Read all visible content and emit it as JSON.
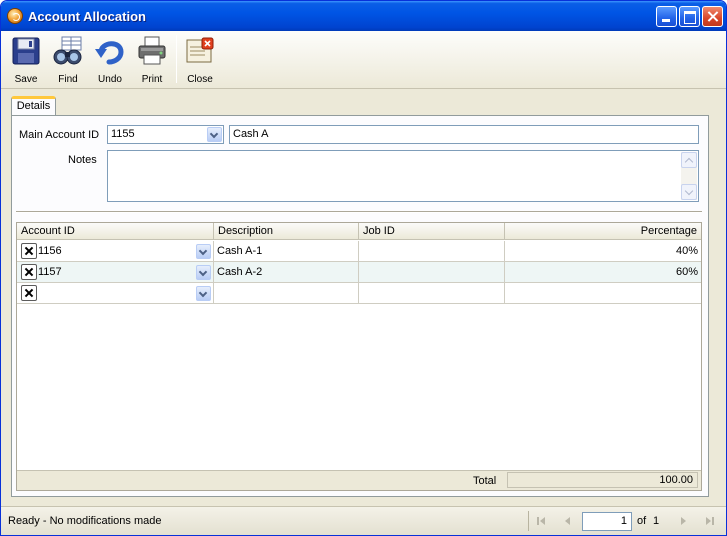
{
  "window": {
    "title": "Account Allocation"
  },
  "toolbar": {
    "save": "Save",
    "find": "Find",
    "undo": "Undo",
    "print": "Print",
    "close": "Close"
  },
  "tabs": [
    {
      "label": "Details",
      "active": true
    }
  ],
  "form": {
    "main_account_label": "Main Account ID",
    "main_account_value": "1155",
    "main_account_description": "Cash A",
    "notes_label": "Notes",
    "notes_value": ""
  },
  "grid": {
    "columns": [
      "Account ID",
      "Description",
      "Job ID",
      "Percentage"
    ],
    "rows": [
      {
        "account_id": "1156",
        "description": "Cash A-1",
        "job_id": "",
        "percentage": "40%"
      },
      {
        "account_id": "1157",
        "description": "Cash A-2",
        "job_id": "",
        "percentage": "60%"
      },
      {
        "account_id": "",
        "description": "",
        "job_id": "",
        "percentage": ""
      }
    ],
    "total_label": "Total",
    "total_value": "100.00"
  },
  "status": {
    "text": "Ready - No modifications made",
    "page": "1",
    "of_label": "of",
    "page_count": "1"
  },
  "icons": {
    "save": "floppy-disk-icon",
    "find": "binoculars-icon",
    "undo": "undo-arrow-icon",
    "print": "printer-icon",
    "close": "close-document-icon"
  },
  "colors": {
    "titlebar": "#0055e5",
    "window_bg": "#ece9d8",
    "tab_accent": "#ffc83c",
    "alt_row": "#eef6f5"
  }
}
